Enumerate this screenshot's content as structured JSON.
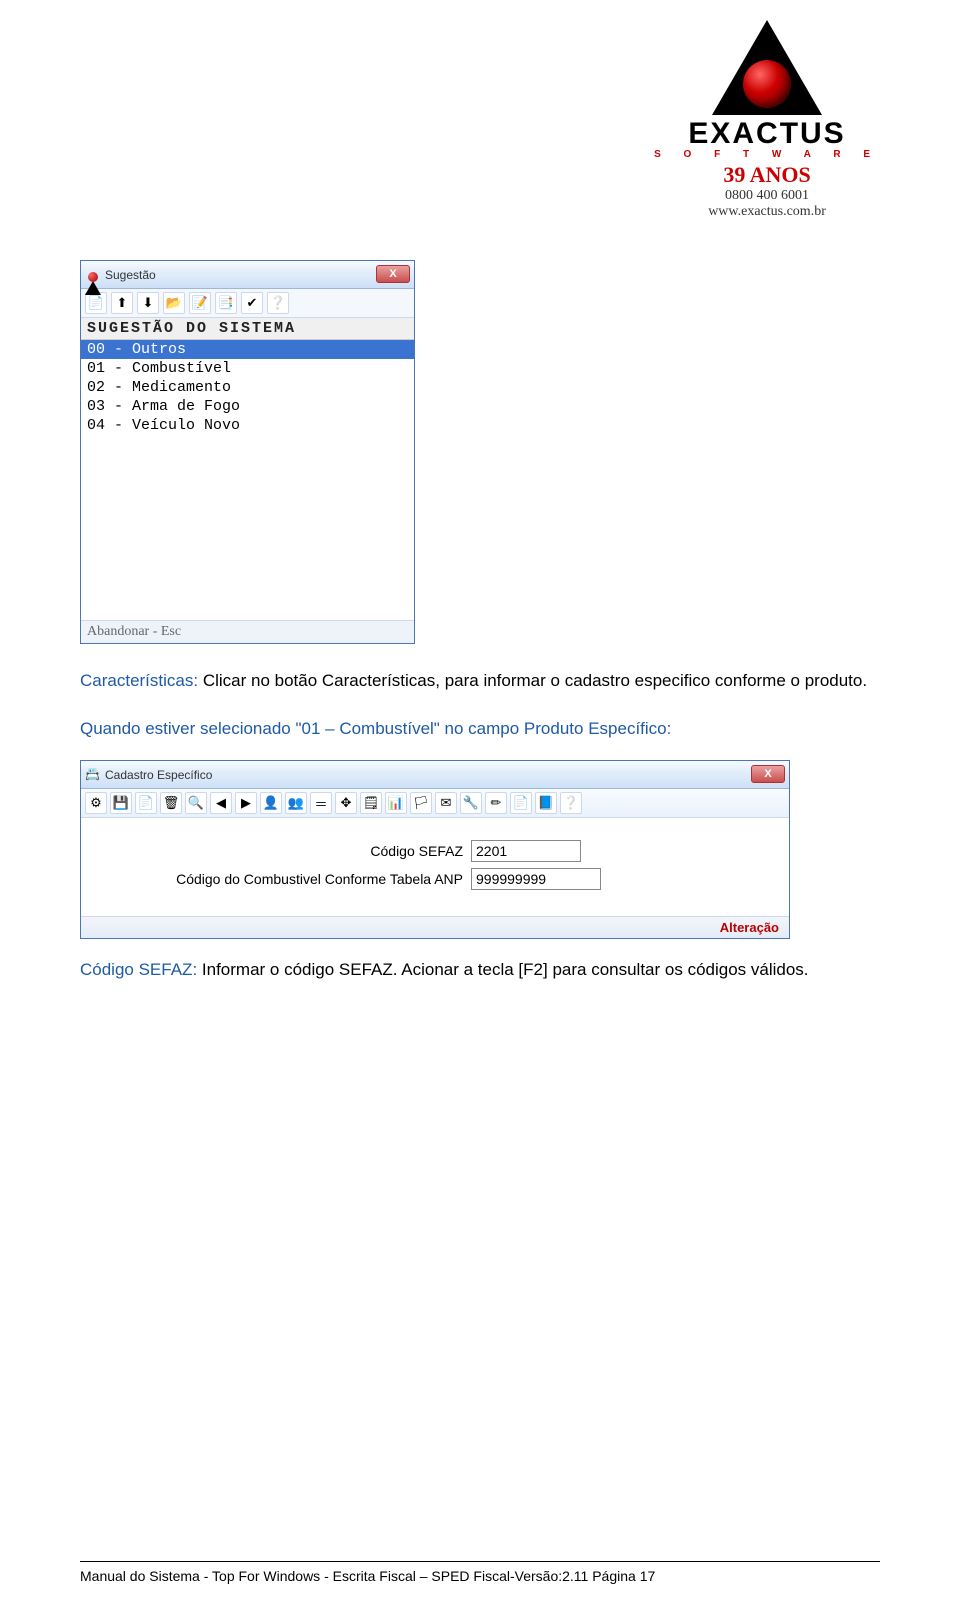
{
  "header": {
    "brand": "EXACTUS",
    "brand_sub": "S O F T W A R E",
    "years": "39 ANOS",
    "phone": "0800 400 6001",
    "url": "www.exactus.com.br"
  },
  "dialog1": {
    "title": "Sugestão",
    "close": "X",
    "toolbar_icons": [
      "📄",
      "⬆",
      "⬇",
      "📂",
      "📝",
      "📑",
      "✔",
      "❔"
    ],
    "list_header": "SUGESTÃO DO SISTEMA",
    "items": [
      {
        "text": "00 - Outros",
        "selected": true
      },
      {
        "text": "01 - Combustível",
        "selected": false
      },
      {
        "text": "02 - Medicamento",
        "selected": false
      },
      {
        "text": "03 - Arma de Fogo",
        "selected": false
      },
      {
        "text": "04 - Veículo Novo",
        "selected": false
      }
    ],
    "status": "Abandonar - Esc"
  },
  "para1": {
    "label": "Características:",
    "text": " Clicar no botão Características, para informar o cadastro especifico conforme o produto."
  },
  "para2": {
    "text": "Quando estiver selecionado \"01 – Combustível\" no campo Produto Específico:"
  },
  "dialog2": {
    "title": "Cadastro Específico",
    "close": "X",
    "toolbar_icons": [
      "⚙",
      "💾",
      "📄",
      "🗑",
      "🔍",
      "◀",
      "▶",
      "👤",
      "👥",
      "＝",
      "✥",
      "🗒",
      "📊",
      "🏳",
      "✉",
      "🔧",
      "✏",
      "📄",
      "📘",
      "❔"
    ],
    "fields": {
      "f1": {
        "label": "Código SEFAZ",
        "value": "2201"
      },
      "f2": {
        "label": "Código do Combustivel Conforme Tabela ANP",
        "value": "999999999"
      }
    },
    "status": "Alteração"
  },
  "para3": {
    "label": "Código SEFAZ:",
    "text": " Informar o código SEFAZ. Acionar a tecla [F2] para consultar os códigos válidos."
  },
  "footer": {
    "text": "Manual do Sistema - Top For Windows - Escrita Fiscal – SPED Fiscal-Versão:2.11 Página 17"
  }
}
